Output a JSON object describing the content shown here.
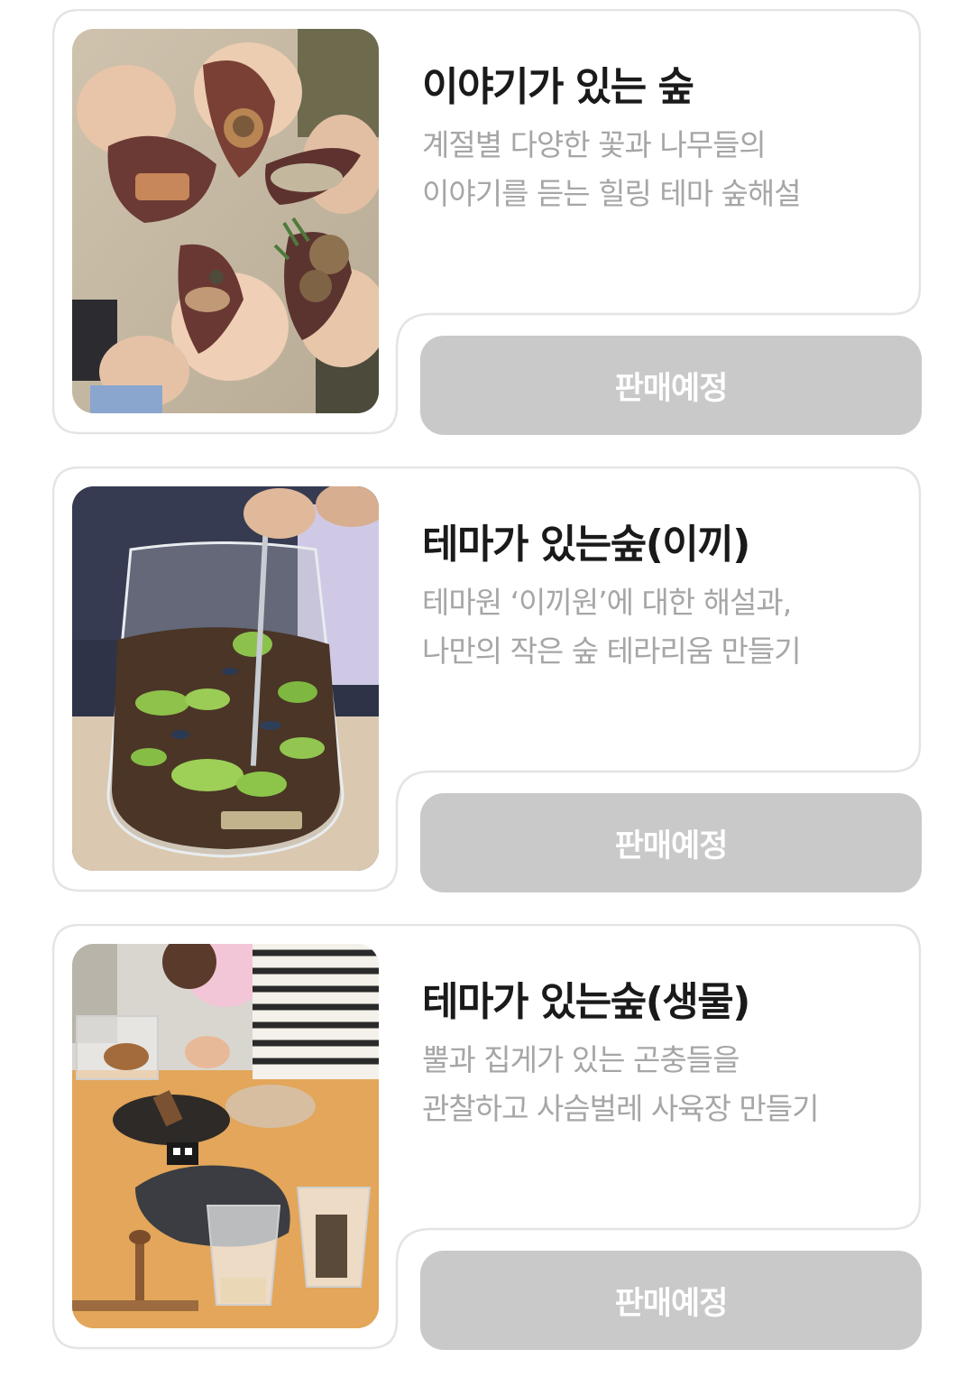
{
  "programs": [
    {
      "title": "이야기가 있는 숲",
      "desc_lines": [
        "계절별 다양한 꽃과 나무들의",
        "이야기를 듣는 힐링 테마 숲해설"
      ],
      "button_label": "판매예정",
      "image_alt": "hands holding leaves and acorns"
    },
    {
      "title": "테마가 있는숲(이끼)",
      "desc_lines": [
        "테마원 ‘이끼원’에 대한 해설과,",
        "나만의 작은 숲 테라리움 만들기"
      ],
      "button_label": "판매예정",
      "image_alt": "moss terrarium in glass vase"
    },
    {
      "title": "테마가 있는숲(생물)",
      "desc_lines": [
        "뿔과 집게가 있는 곤충들을",
        "관찰하고 사슴벌레 사육장 만들기"
      ],
      "button_label": "판매예정",
      "image_alt": "children making stag beetle habitat"
    }
  ],
  "colors": {
    "button_bg": "#c9c9c9",
    "title": "#1a1a1a",
    "desc": "#a6a6a6",
    "card_border": "#e4e4e4"
  }
}
